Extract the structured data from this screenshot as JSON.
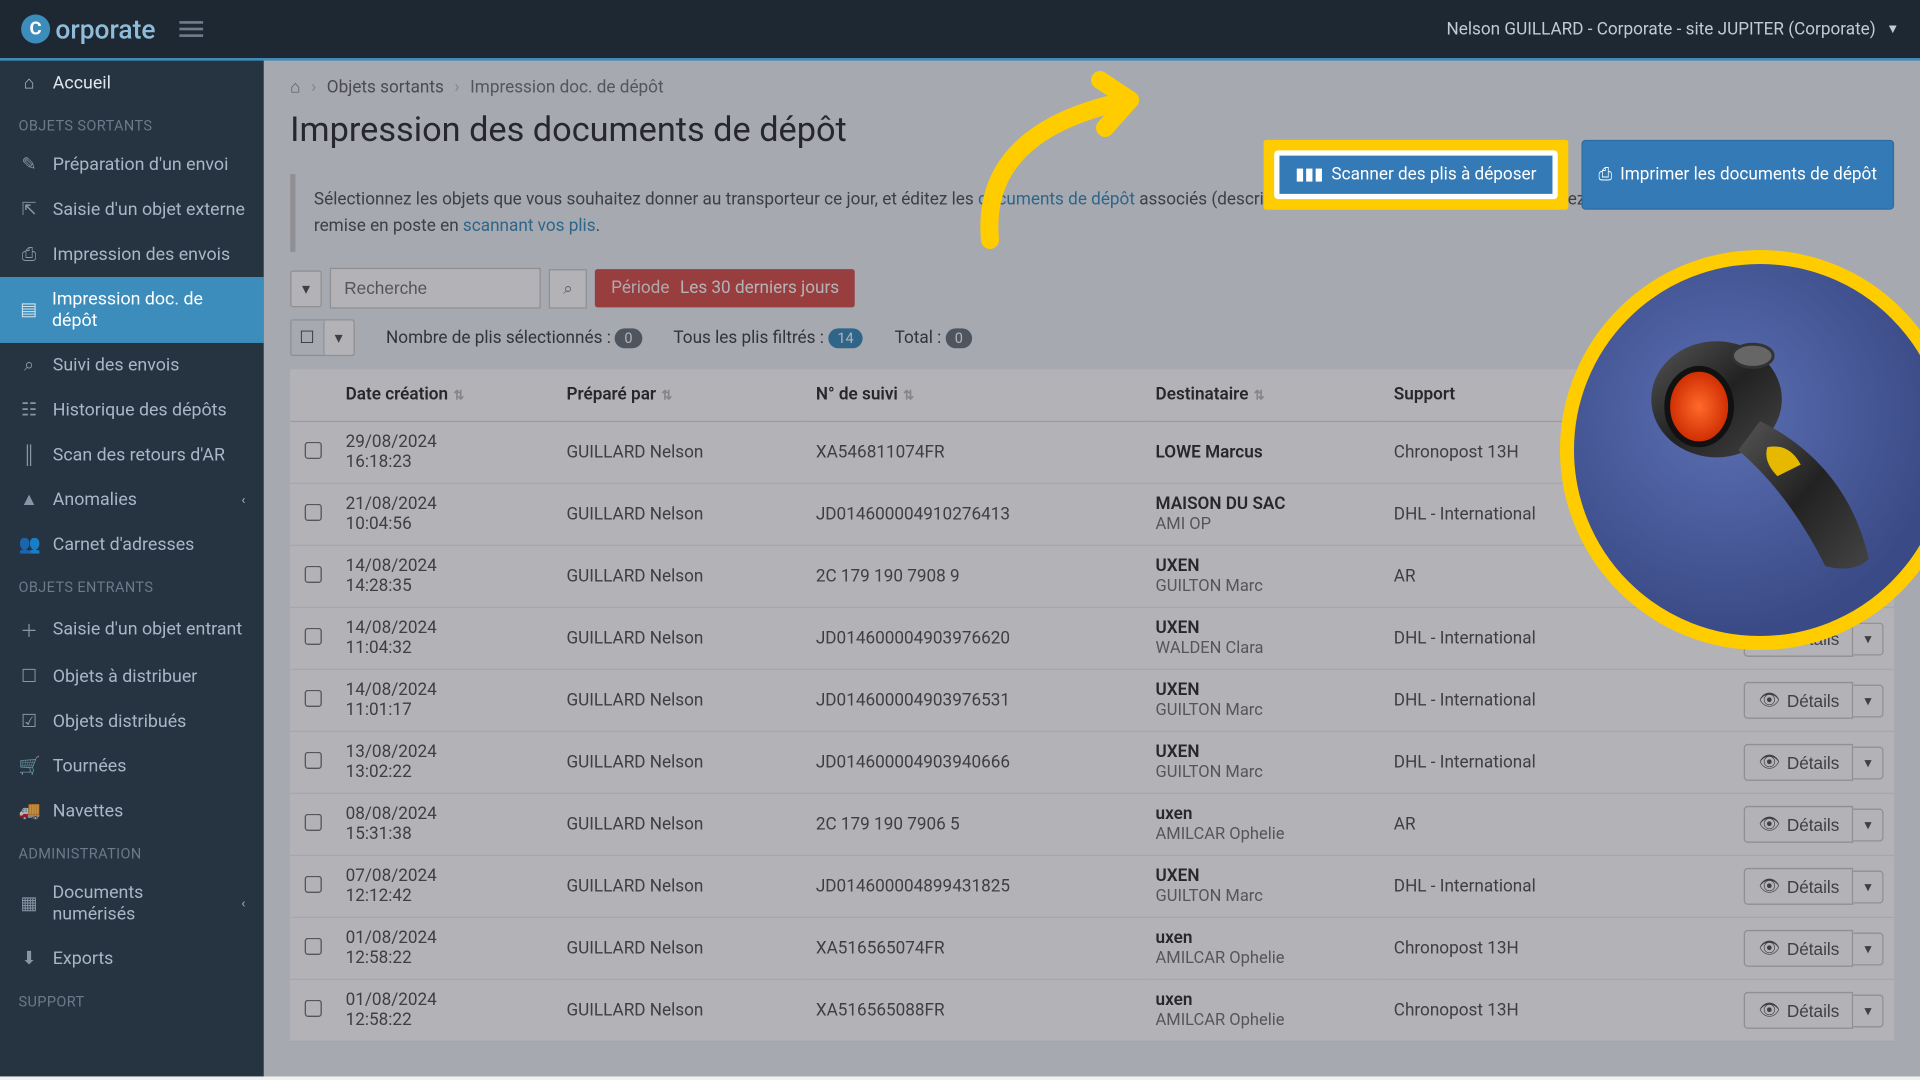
{
  "brand": "orporate",
  "user_line": "Nelson GUILLARD - Corporate - site JUPITER (Corporate)",
  "sidebar": {
    "home": "Accueil",
    "sec1": "OBJETS SORTANTS",
    "items1": [
      "Préparation d'un envoi",
      "Saisie d'un objet externe",
      "Impression des envois",
      "Impression doc. de dépôt",
      "Suivi des envois",
      "Historique des dépôts",
      "Scan des retours d'AR",
      "Anomalies",
      "Carnet d'adresses"
    ],
    "sec2": "OBJETS ENTRANTS",
    "items2": [
      "Saisie d'un objet entrant",
      "Objets à distribuer",
      "Objets distribués",
      "Tournées",
      "Navettes"
    ],
    "sec3": "ADMINISTRATION",
    "items3": [
      "Documents numérisés",
      "Exports"
    ],
    "sec4": "SUPPORT"
  },
  "crumb": {
    "c1": "Objets sortants",
    "c2": "Impression doc. de dépôt"
  },
  "page_title": "Impression des documents de dépôt",
  "buttons": {
    "scan": "Scanner des plis à déposer",
    "print": "Imprimer les documents de dépôt"
  },
  "info": {
    "p1a": "Sélectionnez les objets que vous souhaitez donner au transporteur ce jour, et éditez les ",
    "link1": "documents de dépôt",
    "p1b": " associés (descriptifs de plis, bordereaux de dépôt ... Editez rapidement votre bordereau de remise en poste en ",
    "link2": "scannant vos plis",
    "p1c": "."
  },
  "search_placeholder": "Recherche",
  "period_lbl": "Période",
  "period_val": "Les 30 derniers jours",
  "counts": {
    "sel_lbl": "Nombre de plis sélectionnés :",
    "sel_val": "0",
    "filt_lbl": "Tous les plis filtrés :",
    "filt_val": "14",
    "tot_lbl": "Total :",
    "tot_val": "0"
  },
  "cols": {
    "date": "Date création",
    "prep": "Préparé par",
    "track": "N° de suivi",
    "dest": "Destinataire",
    "supp": "Support"
  },
  "details_label": "Détails",
  "rows": [
    {
      "d1": "29/08/2024",
      "d2": "16:18:23",
      "prep": "GUILLARD Nelson",
      "tr": "XA546811074FR",
      "de1": "LOWE Marcus",
      "de2": "",
      "sup": "Chronopost 13H"
    },
    {
      "d1": "21/08/2024",
      "d2": "10:04:56",
      "prep": "GUILLARD Nelson",
      "tr": "JD014600004910276413",
      "de1": "MAISON DU SAC",
      "de2": "AMI OP",
      "sup": "DHL - International"
    },
    {
      "d1": "14/08/2024",
      "d2": "14:28:35",
      "prep": "GUILLARD Nelson",
      "tr": "2C 179 190 7908 9",
      "de1": "UXEN",
      "de2": "GUILTON Marc",
      "sup": "AR"
    },
    {
      "d1": "14/08/2024",
      "d2": "11:04:32",
      "prep": "GUILLARD Nelson",
      "tr": "JD014600004903976620",
      "de1": "UXEN",
      "de2": "WALDEN Clara",
      "sup": "DHL - International"
    },
    {
      "d1": "14/08/2024",
      "d2": "11:01:17",
      "prep": "GUILLARD Nelson",
      "tr": "JD014600004903976531",
      "de1": "UXEN",
      "de2": "GUILTON Marc",
      "sup": "DHL - International"
    },
    {
      "d1": "13/08/2024",
      "d2": "13:02:22",
      "prep": "GUILLARD Nelson",
      "tr": "JD014600004903940666",
      "de1": "UXEN",
      "de2": "GUILTON Marc",
      "sup": "DHL - International"
    },
    {
      "d1": "08/08/2024",
      "d2": "15:31:38",
      "prep": "GUILLARD Nelson",
      "tr": "2C 179 190 7906 5",
      "de1": "uxen",
      "de2": "AMILCAR Ophelie",
      "sup": "AR"
    },
    {
      "d1": "07/08/2024",
      "d2": "12:12:42",
      "prep": "GUILLARD Nelson",
      "tr": "JD014600004899431825",
      "de1": "UXEN",
      "de2": "GUILTON Marc",
      "sup": "DHL - International"
    },
    {
      "d1": "01/08/2024",
      "d2": "12:58:22",
      "prep": "GUILLARD Nelson",
      "tr": "XA516565074FR",
      "de1": "uxen",
      "de2": "AMILCAR Ophelie",
      "sup": "Chronopost 13H"
    },
    {
      "d1": "01/08/2024",
      "d2": "12:58:22",
      "prep": "GUILLARD Nelson",
      "tr": "XA516565088FR",
      "de1": "uxen",
      "de2": "AMILCAR Ophelie",
      "sup": "Chronopost 13H"
    }
  ]
}
